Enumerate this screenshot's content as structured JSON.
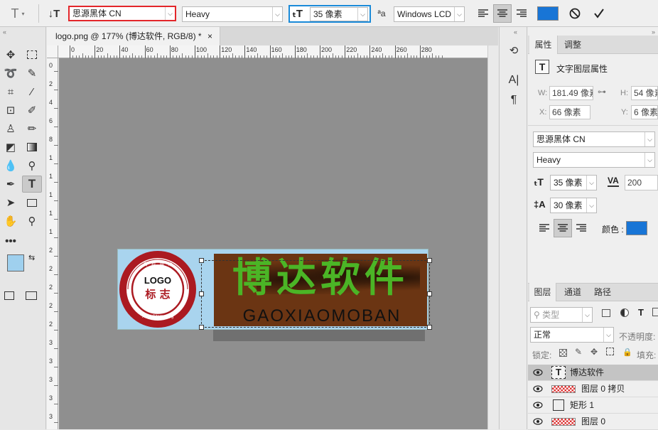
{
  "options_bar": {
    "font_family": "思源黑体 CN",
    "font_style": "Heavy",
    "font_size": "35 像素",
    "antialias_icon_label": "ªa",
    "antialias": "Windows LCD",
    "color": "#1875d6"
  },
  "document": {
    "tab_title": "logo.png @ 177% (博达软件, RGB/8) *",
    "close": "×",
    "ruler_top": [
      "0",
      "20",
      "40",
      "60",
      "80",
      "100",
      "120",
      "140",
      "160",
      "180",
      "200",
      "220",
      "240",
      "260",
      "280"
    ],
    "ruler_top_start": "40",
    "ruler_left": [
      "0",
      "2",
      "4",
      "6",
      "8",
      "1",
      "1",
      "1",
      "1",
      "1",
      "2",
      "2",
      "2",
      "2",
      "2",
      "3",
      "3",
      "3",
      "3",
      "3"
    ]
  },
  "logo": {
    "seal_text_main": "LOGO",
    "seal_text_sub": "标 志",
    "seal_ring_text": "高 校 网 站 模 板",
    "seal_ring_text_bottom": "Xinxi Sitemaking",
    "title": "博达软件",
    "subtitle": "GAOXIAOMOBAN"
  },
  "properties": {
    "tabs": [
      "属性",
      "调整"
    ],
    "layer_kind": "文字图层属性",
    "w_label": "W:",
    "w": "181.49 像素",
    "h_label": "H:",
    "h": "54 像素",
    "x_label": "X:",
    "x": "66 像素",
    "y_label": "Y:",
    "y": "6 像素",
    "font_family": "思源黑体 CN",
    "font_style": "Heavy",
    "size": "35 像素",
    "tracking": "200",
    "leading": "30 像素",
    "color_label": "颜色 :",
    "color": "#1875d6"
  },
  "layers_panel": {
    "tabs": [
      "图层",
      "通道",
      "路径"
    ],
    "filter_kind": "类型",
    "blend_mode": "正常",
    "opacity_label": "不透明度:",
    "lock_label": "锁定:",
    "fill_label": "填充:",
    "layers": [
      {
        "name": "博达软件",
        "type": "text",
        "selected": true
      },
      {
        "name": "图层 0 拷贝",
        "type": "pixel",
        "selected": false
      },
      {
        "name": "矩形 1",
        "type": "shape",
        "selected": false
      },
      {
        "name": "图层 0",
        "type": "pixel",
        "selected": false
      }
    ]
  }
}
